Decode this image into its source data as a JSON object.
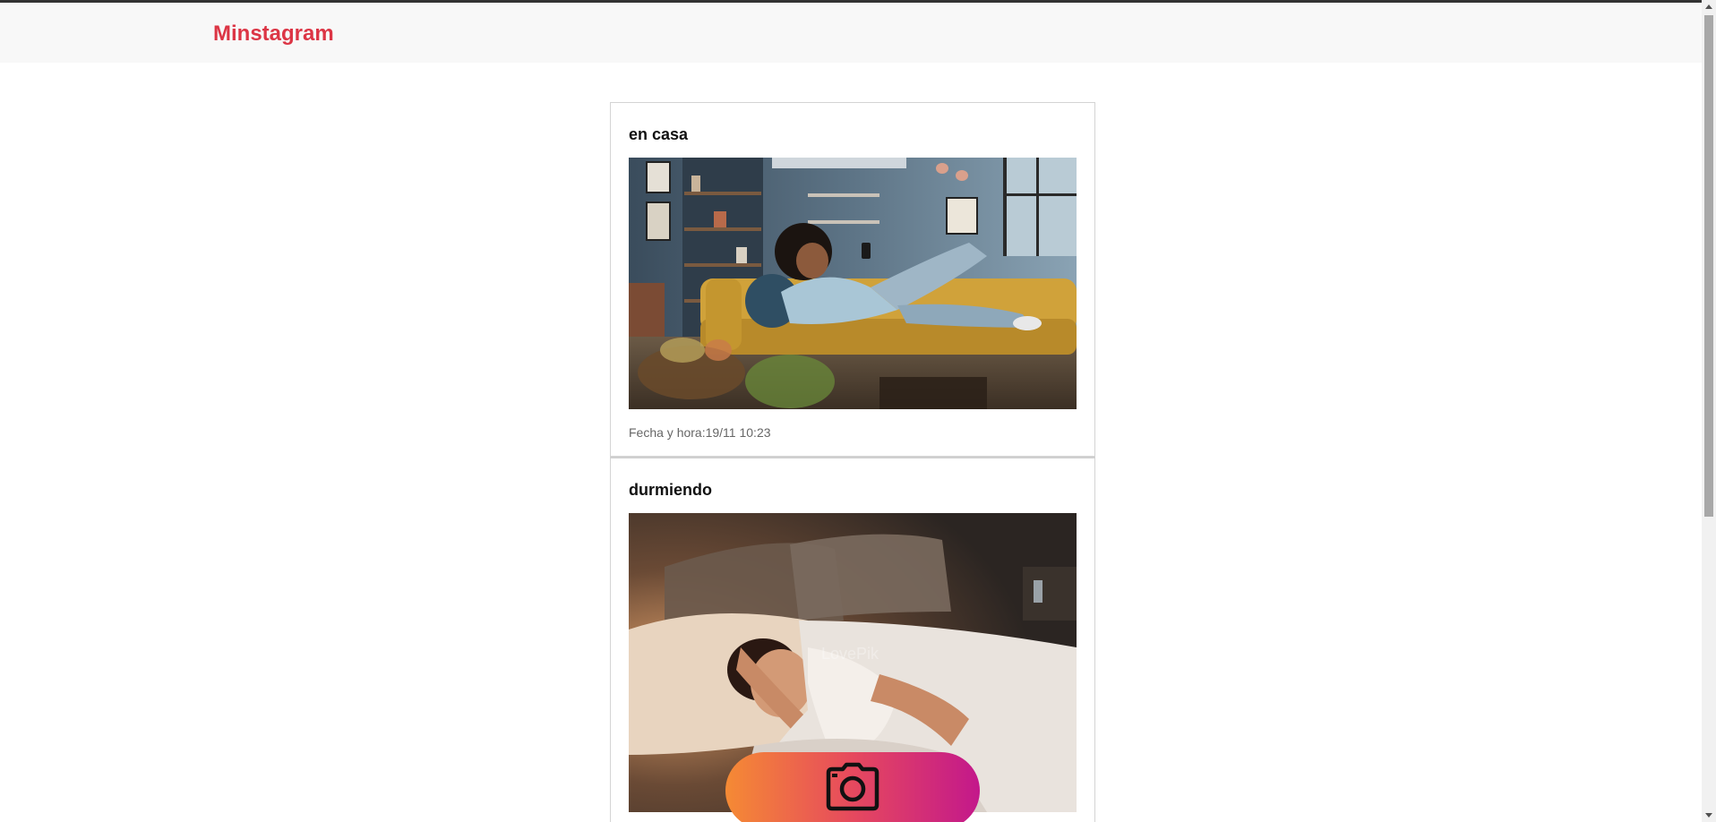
{
  "app": {
    "brand": "Minstagram"
  },
  "posts": [
    {
      "title": "en casa",
      "image_icon": "photo-woman-on-sofa-with-phone",
      "meta": "Fecha y hora:19/11 10:23"
    },
    {
      "title": "durmiendo",
      "image_icon": "photo-woman-sleeping-in-bed",
      "watermark": "LovePik",
      "meta": ""
    }
  ],
  "fab": {
    "icon": "camera-icon",
    "colors": [
      "#f58a34",
      "#e6495e",
      "#c3188b"
    ]
  },
  "colors": {
    "brand": "#dc3545",
    "header_bg": "#f8f8f8",
    "card_border": "#d4d4d4"
  }
}
